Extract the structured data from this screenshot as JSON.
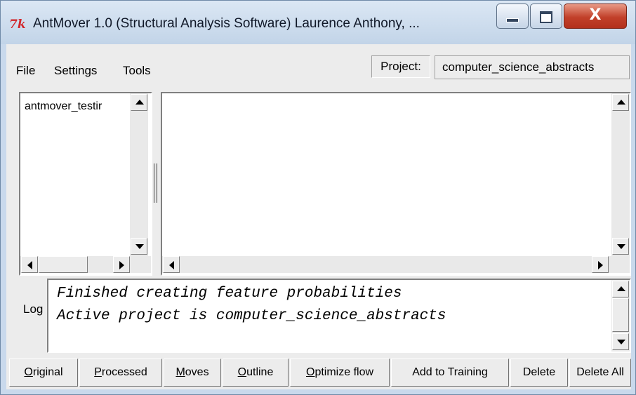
{
  "window": {
    "title": "AntMover 1.0 (Structural Analysis Software) Laurence Anthony, ...",
    "logo": "7k",
    "controls": {
      "minimize": "minimize-icon",
      "maximize": "maximize-icon",
      "close": "X"
    }
  },
  "menubar": {
    "items": [
      "File",
      "Settings",
      "Tools"
    ],
    "project_label": "Project:",
    "project_value": "computer_science_abstracts"
  },
  "file_list": {
    "items": [
      "antmover_testir"
    ]
  },
  "log": {
    "label": "Log",
    "lines": [
      "Finished creating feature probabilities",
      "Active project is computer_science_abstracts"
    ]
  },
  "buttons": [
    {
      "label": "Original",
      "mnemonic": "O"
    },
    {
      "label": "Processed",
      "mnemonic": "P"
    },
    {
      "label": "Moves",
      "mnemonic": "M"
    },
    {
      "label": "Outline",
      "mnemonic": "O"
    },
    {
      "label": "Optimize flow",
      "mnemonic": "O"
    },
    {
      "label": "Add to Training"
    },
    {
      "label": "Delete"
    },
    {
      "label": "Delete All"
    }
  ]
}
